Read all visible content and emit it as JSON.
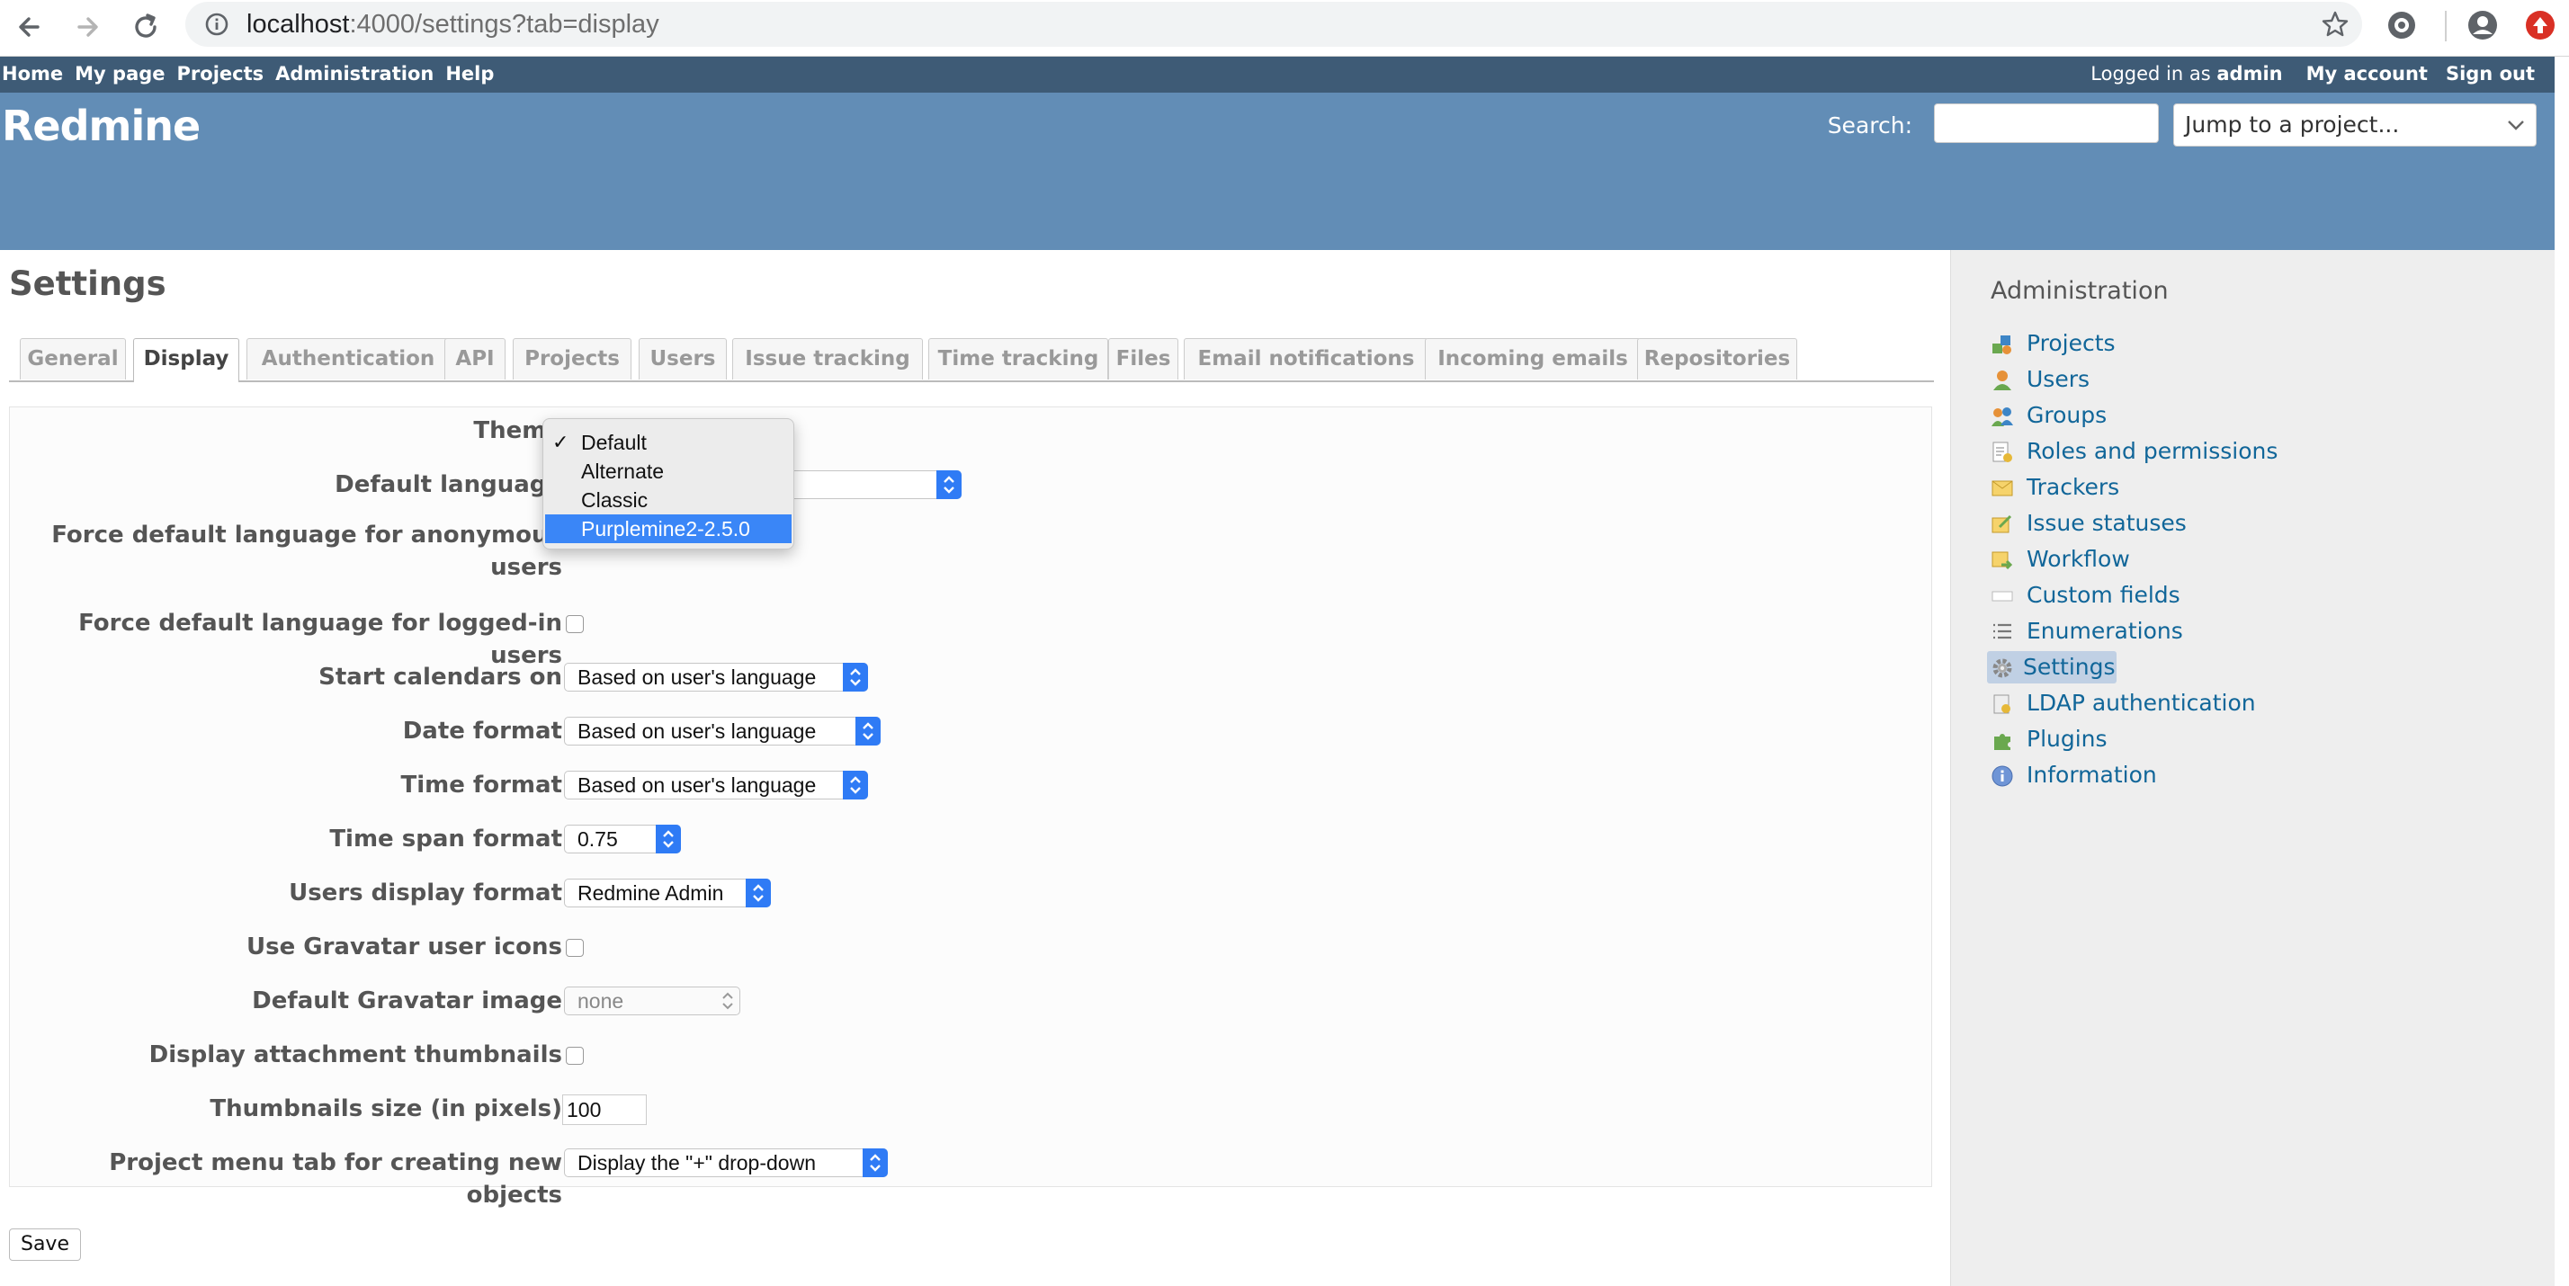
{
  "browser": {
    "url_host": "localhost",
    "url_rest": ":4000/settings?tab=display"
  },
  "top_menu": {
    "items": [
      "Home",
      "My page",
      "Projects",
      "Administration",
      "Help"
    ],
    "logged_in_prefix": "Logged in as",
    "logged_in_user": "admin",
    "my_account": "My account",
    "sign_out": "Sign out"
  },
  "header": {
    "title": "Redmine",
    "search_label": "Search:",
    "search_value": "",
    "jump_placeholder": "Jump to a project..."
  },
  "page": {
    "title": "Settings",
    "tabs": [
      "General",
      "Display",
      "Authentication",
      "API",
      "Projects",
      "Users",
      "Issue tracking",
      "Time tracking",
      "Files",
      "Email notifications",
      "Incoming emails",
      "Repositories"
    ],
    "selected_tab": "Display"
  },
  "form": {
    "theme_label": "Theme",
    "theme_options": [
      "Default",
      "Alternate",
      "Classic",
      "Purplemine2-2.5.0"
    ],
    "theme_checked": "Default",
    "theme_highlighted": "Purplemine2-2.5.0",
    "default_language_label": "Default language",
    "force_anon_label_1": "Force default language for anonymous",
    "force_anon_label_2": "users",
    "force_logged_label": "Force default language for logged-in users",
    "start_calendars_label": "Start calendars on",
    "start_calendars_value": "Based on user's language",
    "date_format_label": "Date format",
    "date_format_value": "Based on user's language",
    "time_format_label": "Time format",
    "time_format_value": "Based on user's language",
    "time_span_label": "Time span format",
    "time_span_value": "0.75",
    "users_display_label": "Users display format",
    "users_display_value": "Redmine Admin",
    "gravatar_label": "Use Gravatar user icons",
    "default_gravatar_label": "Default Gravatar image",
    "default_gravatar_value": "none",
    "thumbnails_label": "Display attachment thumbnails",
    "thumb_size_label": "Thumbnails size (in pixels)",
    "thumb_size_value": "100",
    "project_menu_label": "Project menu tab for creating new objects",
    "project_menu_value": "Display the \"+\" drop-down",
    "save": "Save"
  },
  "sidebar": {
    "title": "Administration",
    "items": [
      {
        "label": "Projects",
        "icon": "projects-icon"
      },
      {
        "label": "Users",
        "icon": "user-icon"
      },
      {
        "label": "Groups",
        "icon": "group-icon"
      },
      {
        "label": "Roles and permissions",
        "icon": "roles-icon"
      },
      {
        "label": "Trackers",
        "icon": "tracker-icon"
      },
      {
        "label": "Issue statuses",
        "icon": "issue-status-icon"
      },
      {
        "label": "Workflow",
        "icon": "workflow-icon"
      },
      {
        "label": "Custom fields",
        "icon": "custom-fields-icon"
      },
      {
        "label": "Enumerations",
        "icon": "list-icon"
      },
      {
        "label": "Settings",
        "icon": "gear-icon"
      },
      {
        "label": "LDAP authentication",
        "icon": "ldap-icon"
      },
      {
        "label": "Plugins",
        "icon": "plugin-icon"
      },
      {
        "label": "Information",
        "icon": "info-icon"
      }
    ],
    "selected": "Settings"
  },
  "colors": {
    "top_menu_bg": "#3e5b76",
    "header_bg": "#628db6",
    "link": "#116699",
    "select_accent": "#2f7bf5"
  }
}
